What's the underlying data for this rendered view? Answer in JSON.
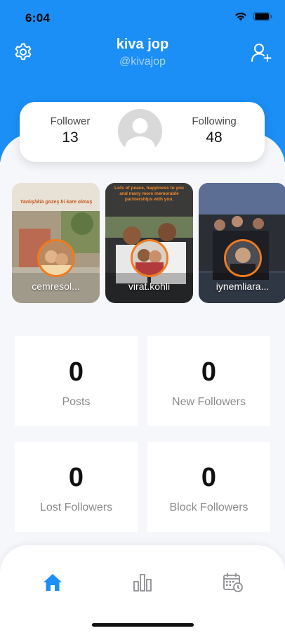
{
  "status_bar": {
    "time": "6:04"
  },
  "profile": {
    "name": "kiva jop",
    "handle": "@kivajop"
  },
  "stats": {
    "follower_label": "Follower",
    "follower_value": "13",
    "following_label": "Following",
    "following_value": "48"
  },
  "stories": [
    {
      "name": "cemresol...",
      "caption": "Yanlışlıkla güzeş bi kare olmuş"
    },
    {
      "name": "virat.kohli",
      "caption": "Lots of peace, happiness to you and many more memorable partnerships with you."
    },
    {
      "name": "iynemliara..."
    }
  ],
  "metrics": [
    {
      "value": "0",
      "label": "Posts"
    },
    {
      "value": "0",
      "label": "New Followers"
    },
    {
      "value": "0",
      "label": "Lost Followers"
    },
    {
      "value": "0",
      "label": "Block Followers"
    }
  ],
  "nav": {
    "items": [
      "home-icon",
      "bar-chart-icon",
      "calendar-icon"
    ],
    "active": "home-icon"
  },
  "colors": {
    "brand": "#1b8ff5",
    "story_ring": "#f07b1e",
    "nav_inactive": "#8e8e93"
  }
}
